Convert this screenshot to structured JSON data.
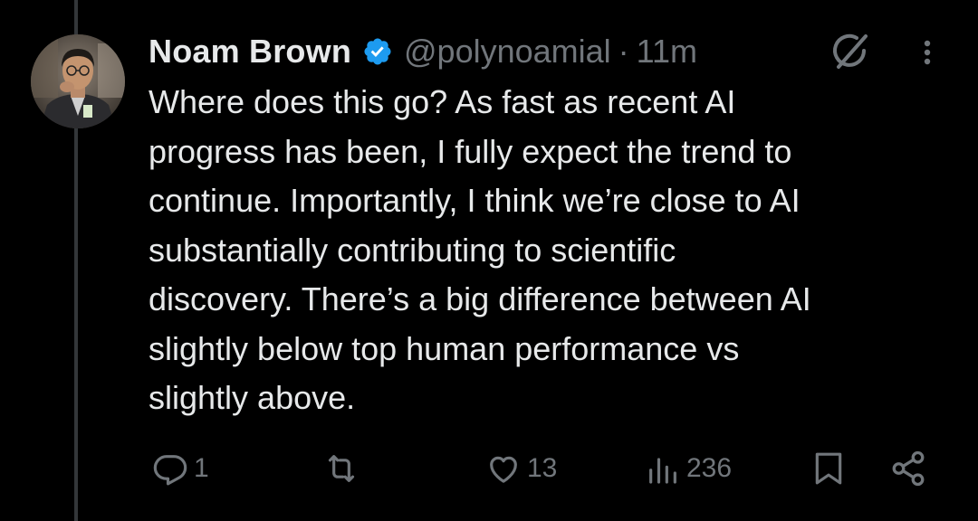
{
  "tweet": {
    "author_name": "Noam Brown",
    "handle": "@polynoamial",
    "separator": "·",
    "time": "11m",
    "text": "Where does this go? As fast as recent AI\nprogress has been, I fully expect the trend to\ncontinue. Importantly, I think we’re close to AI\nsubstantially contributing to scientific\ndiscovery. There’s a big difference between AI\nslightly below top human performance vs\nslightly above."
  },
  "icons": {
    "verified": "verified-badge-icon",
    "grok": "grok-icon",
    "more": "more-options-icon",
    "reply": "reply-icon",
    "retweet": "retweet-icon",
    "like": "like-icon",
    "views": "views-icon",
    "bookmark": "bookmark-icon",
    "share": "share-icon"
  },
  "actions": {
    "replies": "1",
    "retweets": "",
    "likes": "13",
    "views": "236"
  },
  "colors": {
    "background": "#000000",
    "text": "#e7e9ea",
    "muted": "#71767b",
    "verified": "#1d9bf0"
  }
}
